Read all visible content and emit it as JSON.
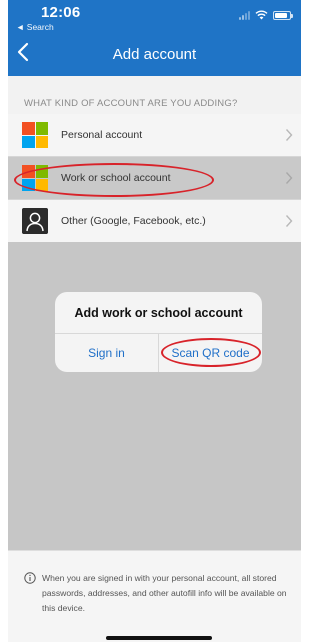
{
  "status_bar": {
    "time": "12:06",
    "back_app": "◄ Search"
  },
  "nav": {
    "title": "Add account"
  },
  "section": {
    "header": "WHAT KIND OF ACCOUNT ARE YOU ADDING?"
  },
  "accounts": [
    {
      "label": "Personal account",
      "icon": "microsoft-logo-icon"
    },
    {
      "label": "Work or school account",
      "icon": "microsoft-logo-icon",
      "selected": true
    },
    {
      "label": "Other (Google, Facebook, etc.)",
      "icon": "person-icon"
    }
  ],
  "dialog": {
    "title": "Add work or school account",
    "sign_in": "Sign in",
    "scan_qr": "Scan QR code"
  },
  "footer": {
    "info": "When you are signed in with your personal account, all stored passwords, addresses, and other autofill info will be available on this device."
  },
  "colors": {
    "nav_blue": "#1f74c6",
    "link_blue": "#1f6fc8",
    "annotation_red": "#d8232a",
    "ms_red": "#f25022",
    "ms_green": "#7fba00",
    "ms_blue": "#00a4ef",
    "ms_yellow": "#ffb900"
  }
}
